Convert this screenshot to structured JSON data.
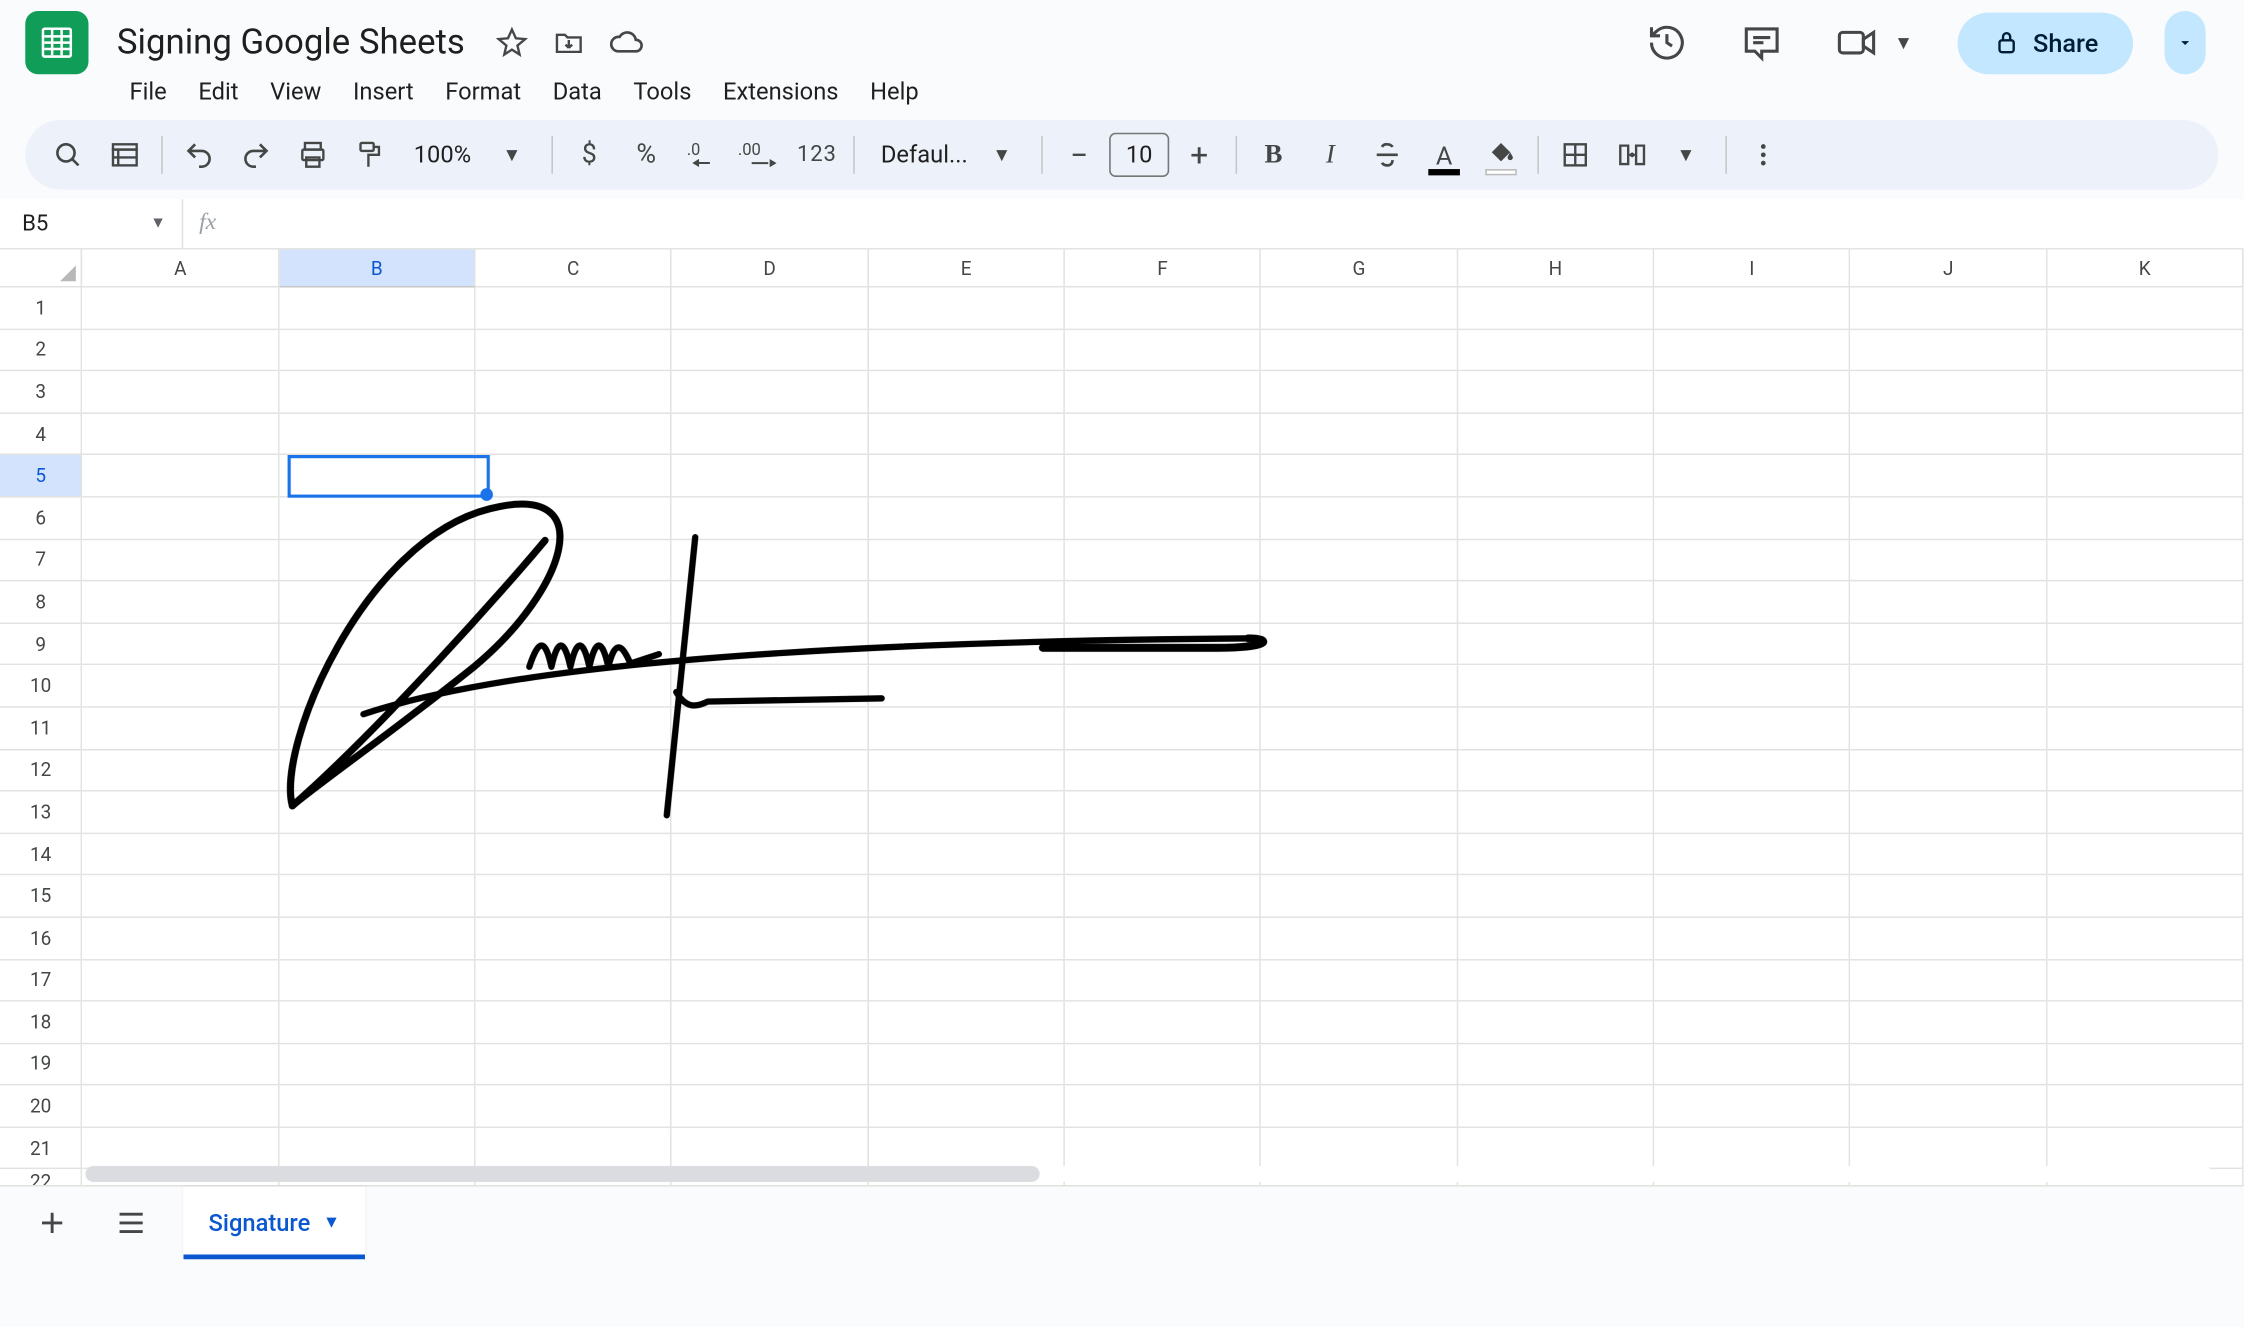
{
  "doc": {
    "title": "Signing Google Sheets"
  },
  "menus": [
    "File",
    "Edit",
    "View",
    "Insert",
    "Format",
    "Data",
    "Tools",
    "Extensions",
    "Help"
  ],
  "toolbar": {
    "zoom": "100%",
    "font": "Defaul...",
    "fontsize": "10",
    "format123": "123"
  },
  "namebox": {
    "ref": "B5"
  },
  "columns": [
    "A",
    "B",
    "C",
    "D",
    "E",
    "F",
    "G",
    "H",
    "I",
    "J",
    "K"
  ],
  "active_cell": {
    "col": "B",
    "row": 5
  },
  "rows_visible": 21,
  "sheet": {
    "active_tab": "Signature"
  },
  "share": {
    "label": "Share"
  }
}
